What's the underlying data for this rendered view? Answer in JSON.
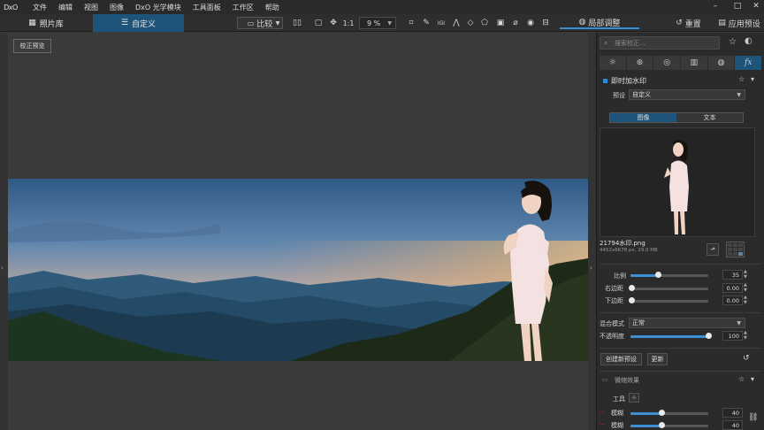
{
  "menubar": {
    "logo": "DxO",
    "items": [
      "文件",
      "编辑",
      "视图",
      "图像",
      "DxO 光学模块",
      "工具面板",
      "工作区",
      "帮助"
    ]
  },
  "toolbar": {
    "library_tab": "照片库",
    "custom_tab": "自定义",
    "compare_label": "比较",
    "ratio_label": "1:1",
    "zoom_value": "9 %",
    "local_adjust_label": "局部调整",
    "reset_label": "重置",
    "apply_preset_label": "应用预设"
  },
  "canvas": {
    "proof_button": "校正预览"
  },
  "panel": {
    "search_placeholder": "搜索校正...",
    "watermark_title": "即时加水印",
    "preset_label": "预设",
    "preset_value": "自定义",
    "mode_image": "图像",
    "mode_text": "文本",
    "file_name": "21794水印.png",
    "file_meta": "4452x6678 px, 29.0 MB",
    "scale_label": "比例",
    "scale_value": "35",
    "scale_level": 0.35,
    "right_margin_label": "右边距",
    "right_margin_value": "0.00",
    "bottom_margin_label": "下边距",
    "bottom_margin_value": "0.00",
    "blend_label": "混合模式",
    "blend_value": "正常",
    "opacity_label": "不透明度",
    "opacity_value": "100",
    "opacity_level": 1.0,
    "new_preset_button": "创建新预设",
    "update_button": "更新",
    "tilt_title": "微缩效果",
    "tool_label": "工具",
    "blur1_label": "模糊",
    "blur1_value": "40",
    "blur2_label": "模糊",
    "blur2_value": "40",
    "blur_level": 0.4
  },
  "colors": {
    "accent_blue": "#1e5479",
    "slider_blue": "#3d8fd6",
    "panel_bg": "#2b2b2b",
    "canvas_bg": "#3a3a3a"
  }
}
